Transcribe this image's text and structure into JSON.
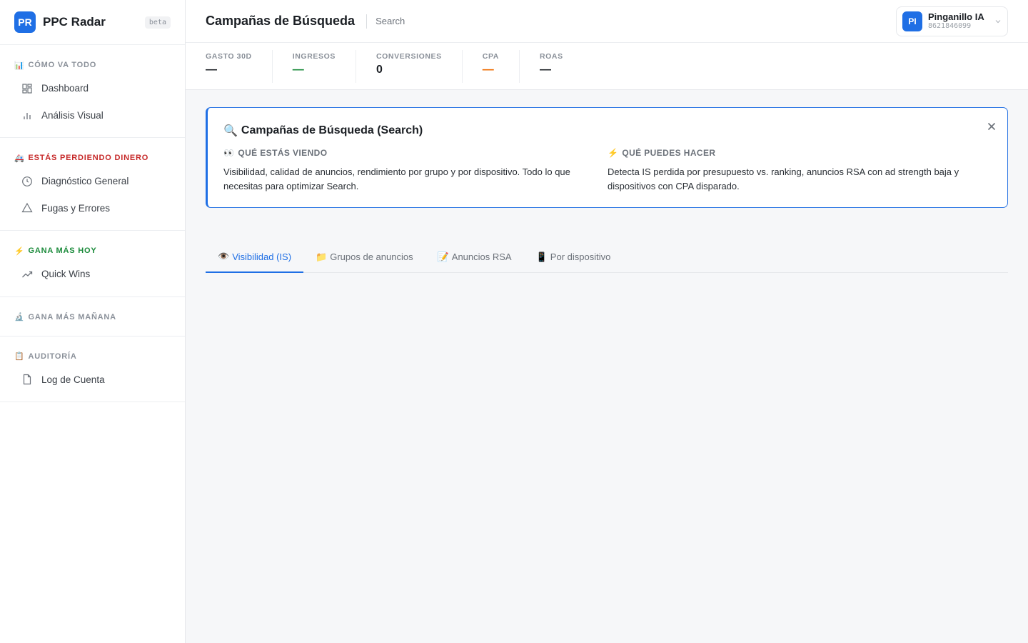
{
  "brand": {
    "logo": "PR",
    "name": "PPC Radar",
    "badge": "beta"
  },
  "sidebar": {
    "sections": [
      {
        "emoji": "📊",
        "title": "CÓMO VA TODO",
        "items": [
          {
            "label": "Dashboard",
            "icon": "grid-icon"
          },
          {
            "label": "Análisis Visual",
            "icon": "bar-chart-icon"
          }
        ]
      },
      {
        "emoji": "🚑",
        "title": "ESTÁS PERDIENDO DINERO",
        "color": "#c62828",
        "items": [
          {
            "label": "Diagnóstico General",
            "icon": "clock-icon"
          },
          {
            "label": "Fugas y Errores",
            "icon": "warning-icon"
          }
        ]
      },
      {
        "emoji": "⚡",
        "title": "GANA MÁS HOY",
        "color": "#1a8a3a",
        "items": [
          {
            "label": "Quick Wins",
            "icon": "trending-up-icon"
          }
        ]
      },
      {
        "emoji": "🔬",
        "title": "GANA MÁS MAÑANA",
        "items": []
      },
      {
        "emoji": "📋",
        "title": "AUDITORÍA",
        "items": [
          {
            "label": "Log de Cuenta",
            "icon": "file-icon"
          }
        ]
      }
    ]
  },
  "header": {
    "title": "Campañas de Búsqueda",
    "crumb": "Search"
  },
  "account": {
    "initials": "PI",
    "name": "Pinganillo IA",
    "id": "8621846099"
  },
  "kpis": [
    {
      "label": "GASTO 30D",
      "value": "—"
    },
    {
      "label": "INGRESOS",
      "value": "—",
      "color": "#1a8a3a"
    },
    {
      "label": "CONVERSIONES",
      "value": "0"
    },
    {
      "label": "CPA",
      "value": "—",
      "color": "#ef6c00"
    },
    {
      "label": "ROAS",
      "value": "—"
    }
  ],
  "info": {
    "emoji": "🔍",
    "title": "Campañas de Búsqueda (Search)",
    "left": {
      "emoji": "👀",
      "title": "QUÉ ESTÁS VIENDO",
      "text": "Visibilidad, calidad de anuncios, rendimiento por grupo y por dispositivo. Todo lo que necesitas para optimizar Search."
    },
    "right": {
      "emoji": "⚡",
      "title": "QUÉ PUEDES HACER",
      "text": "Detecta IS perdida por presupuesto vs. ranking, anuncios RSA con ad strength baja y dispositivos con CPA disparado."
    }
  },
  "tabs": [
    {
      "emoji": "👁️",
      "label": "Visibilidad (IS)",
      "active": true
    },
    {
      "emoji": "📁",
      "label": "Grupos de anuncios"
    },
    {
      "emoji": "📝",
      "label": "Anuncios RSA"
    },
    {
      "emoji": "📱",
      "label": "Por dispositivo"
    }
  ],
  "colors": {
    "accent": "#1f6fe5",
    "danger": "#c62828",
    "success": "#1a8a3a",
    "warning": "#ef6c00"
  }
}
